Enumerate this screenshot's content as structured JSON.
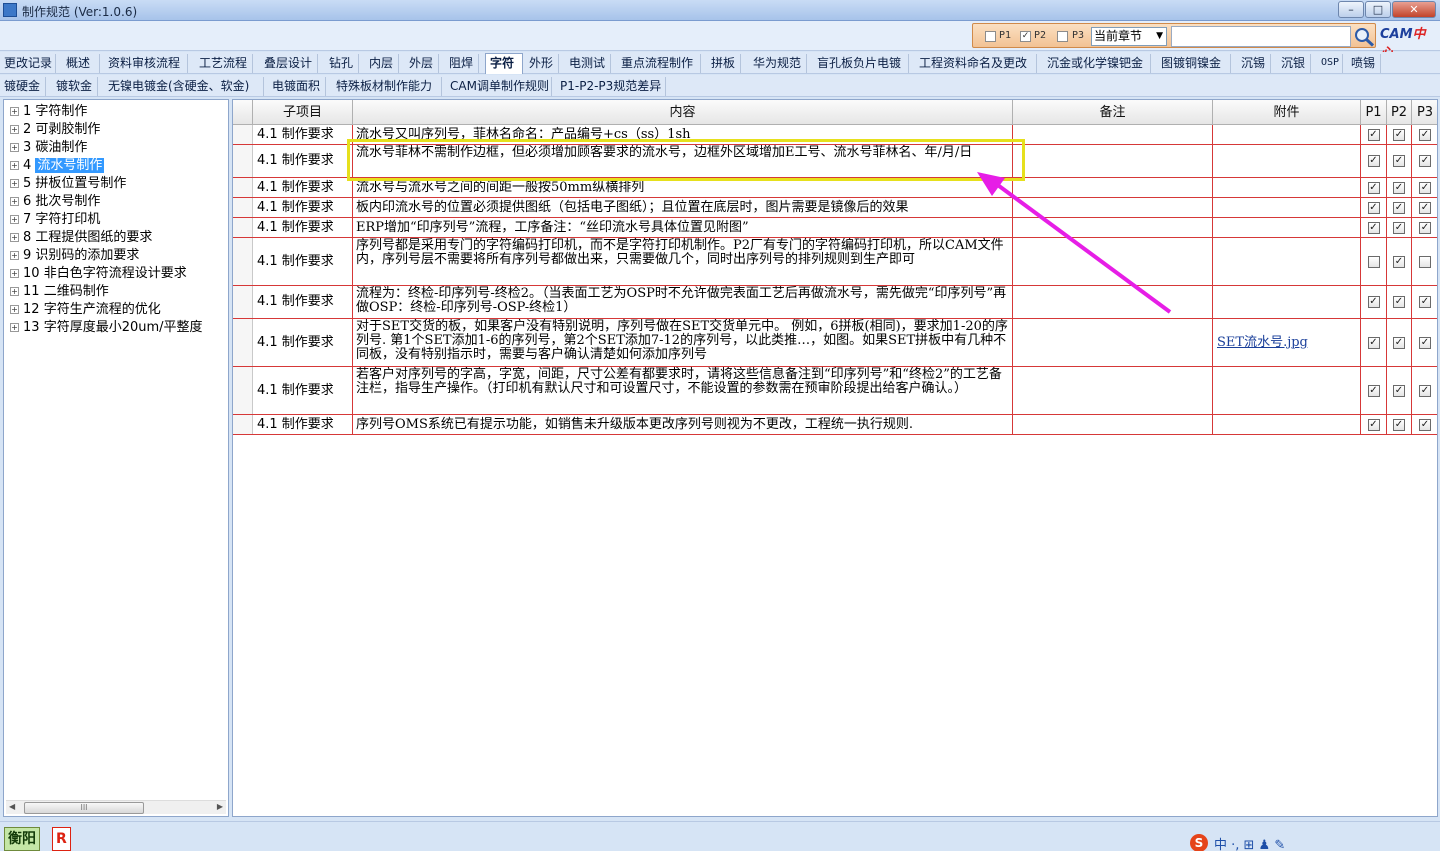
{
  "window": {
    "title": "制作规范 (Ver:1.0.6)",
    "minimize": "–",
    "maximize": "□",
    "close": "✕"
  },
  "toolbar": {
    "filters": [
      {
        "label": "P1",
        "checked": false
      },
      {
        "label": "P2",
        "checked": true
      },
      {
        "label": "P3",
        "checked": false
      }
    ],
    "chapter_select": "当前章节",
    "search_value": "",
    "logo_main": "CAM",
    "logo_accent": "中心"
  },
  "tabs_row1": [
    "更改记录",
    "概述",
    "资料审核流程",
    "工艺流程",
    "叠层设计",
    "钻孔",
    "内层",
    "外层",
    "阻焊",
    "字符",
    "外形",
    "电测试",
    "重点流程制作",
    "拼板",
    "华为规范",
    "盲孔板负片电镀",
    "工程资料命名及更改",
    "沉金或化学镍钯金",
    "图镀铜镍金",
    "沉锡",
    "沉银",
    "OSP",
    "喷锡"
  ],
  "tabs_row2": [
    "镀硬金",
    "镀软金",
    "无镍电镀金(含硬金、软金)",
    "电镀面积",
    "特殊板材制作能力",
    "CAM调单制作规则",
    "P1-P2-P3规范差异"
  ],
  "active_tab": "字符",
  "tree": {
    "items": [
      {
        "num": "1",
        "label": "字符制作"
      },
      {
        "num": "2",
        "label": "可剥胶制作"
      },
      {
        "num": "3",
        "label": "碳油制作"
      },
      {
        "num": "4",
        "label": "流水号制作",
        "selected": true
      },
      {
        "num": "5",
        "label": "拼板位置号制作"
      },
      {
        "num": "6",
        "label": "批次号制作"
      },
      {
        "num": "7",
        "label": "字符打印机"
      },
      {
        "num": "8",
        "label": "工程提供图纸的要求"
      },
      {
        "num": "9",
        "label": "识别码的添加要求"
      },
      {
        "num": "10",
        "label": "非白色字符流程设计要求"
      },
      {
        "num": "11",
        "label": "二维码制作"
      },
      {
        "num": "12",
        "label": "字符生产流程的优化"
      },
      {
        "num": "13",
        "label": "字符厚度最小20um/平整度"
      }
    ]
  },
  "grid": {
    "headers": {
      "sub": "子项目",
      "content": "内容",
      "remark": "备注",
      "attach": "附件",
      "p1": "P1",
      "p2": "P2",
      "p3": "P3"
    },
    "rows": [
      {
        "sub": "4.1 制作要求",
        "content": "流水号又叫序列号，菲林名命名：产品编号+cs（ss）1sh",
        "remark": "",
        "attach": "",
        "p1": true,
        "p2": true,
        "p3": true
      },
      {
        "sub": "4.1 制作要求",
        "content": "流水号菲林不需制作边框，但必须增加顾客要求的流水号，边框外区域增加E工号、流水号菲林名、年/月/日",
        "remark": "",
        "attach": "",
        "p1": true,
        "p2": true,
        "p3": true
      },
      {
        "sub": "4.1 制作要求",
        "content": "流水号与流水号之间的间距一般按50mm纵横排列",
        "remark": "",
        "attach": "",
        "p1": true,
        "p2": true,
        "p3": true
      },
      {
        "sub": "4.1 制作要求",
        "content": "板内印流水号的位置必须提供图纸（包括电子图纸）；且位置在底层时，图片需要是镜像后的效果",
        "remark": "",
        "attach": "",
        "p1": true,
        "p2": true,
        "p3": true
      },
      {
        "sub": "4.1 制作要求",
        "content": "ERP增加“印序列号”流程，工序备注：“丝印流水号具体位置见附图”",
        "remark": "",
        "attach": "",
        "p1": true,
        "p2": true,
        "p3": true
      },
      {
        "sub": "4.1 制作要求",
        "content": "序列号都是采用专门的字符编码打印机，而不是字符打印机制作。P2厂有专门的字符编码打印机，所以CAM文件内，序列号层不需要将所有序列号都做出来，只需要做几个，同时出序列号的排列规则到生产即可",
        "remark": "",
        "attach": "",
        "p1": false,
        "p2": true,
        "p3": false
      },
      {
        "sub": "4.1 制作要求",
        "content": "流程为：终检-印序列号-终检2。（当表面工艺为OSP时不允许做完表面工艺后再做流水号，需先做完“印序列号”再做OSP：终检-印序列号-OSP-终检1）",
        "remark": "",
        "attach": "",
        "p1": true,
        "p2": true,
        "p3": true
      },
      {
        "sub": "4.1 制作要求",
        "content": "对于SET交货的板，如果客户没有特别说明，序列号做在SET交货单元中。 例如，6拼板(相同)，要求加1-20的序列号. 第1个SET添加1-6的序列号，第2个SET添加7-12的序列号，以此类推…，如图。如果SET拼板中有几种不同板，没有特别指示时，需要与客户确认清楚如何添加序列号",
        "remark": "",
        "attach": "SET流水号.jpg",
        "p1": true,
        "p2": true,
        "p3": true
      },
      {
        "sub": "4.1 制作要求",
        "content": "若客户对序列号的字高，字宽，间距，尺寸公差有都要求时，请将这些信息备注到“印序列号”和“终检2”的工艺备注栏，指导生产操作。（打印机有默认尺寸和可设置尺寸，不能设置的参数需在预审阶段提出给客户确认。）",
        "remark": "",
        "attach": "",
        "p1": true,
        "p2": true,
        "p3": true
      },
      {
        "sub": "4.1 制作要求",
        "content": "序列号OMS系统已有提示功能，如销售未升级版本更改序列号则视为不更改，工程统一执行规则.",
        "remark": "",
        "attach": "",
        "p1": true,
        "p2": true,
        "p3": true
      }
    ]
  },
  "statusbar": {
    "city_badge": "衡阳",
    "r_badge": "R",
    "ime_text": "中 ·, ⊞ ♟ ✎"
  },
  "colors": {
    "grid_line": "#d63838",
    "highlight": "#e6e01c",
    "arrow": "#e61ee6",
    "selection": "#3399ff"
  }
}
